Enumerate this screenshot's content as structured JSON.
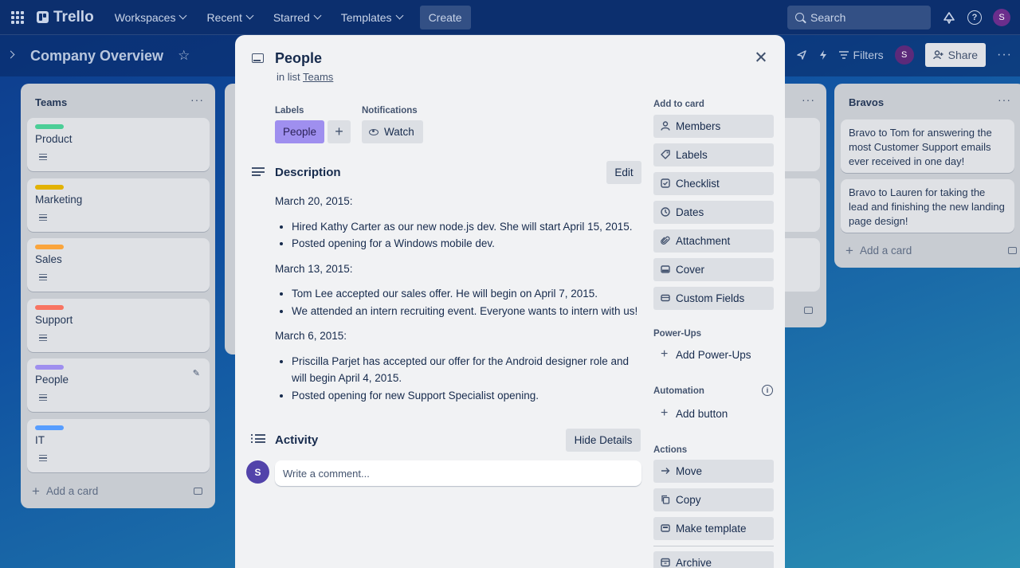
{
  "nav": {
    "logo": "Trello",
    "menus": [
      "Workspaces",
      "Recent",
      "Starred",
      "Templates"
    ],
    "create": "Create",
    "search_placeholder": "Search",
    "user_initial": "S"
  },
  "board": {
    "title": "Company Overview",
    "filters": "Filters",
    "share": "Share",
    "member_initial": "S"
  },
  "lists": {
    "teams": {
      "title": "Teams",
      "cards": [
        {
          "label": "Product",
          "color": "#4bce97"
        },
        {
          "label": "Marketing",
          "color": "#e2b203"
        },
        {
          "label": "Sales",
          "color": "#faa53d"
        },
        {
          "label": "Support",
          "color": "#f87462"
        },
        {
          "label": "People",
          "color": "#9f8fef"
        },
        {
          "label": "IT",
          "color": "#579dff"
        }
      ],
      "add_card": "Add a card"
    },
    "bravos": {
      "title": "Bravos",
      "cards": [
        "Bravo to Tom for answering the most Customer Support emails ever received in one day!",
        "Bravo to Lauren for taking the lead and finishing the new landing page design!"
      ],
      "add_card": "Add a card"
    }
  },
  "modal": {
    "title": "People",
    "in_list_prefix": "in list",
    "in_list_name": "Teams",
    "labels_heading": "Labels",
    "label_chip": "People",
    "notifications_heading": "Notifications",
    "watch": "Watch",
    "description_title": "Description",
    "edit": "Edit",
    "description": {
      "date1": "March 20, 2015:",
      "items1": [
        "Hired Kathy Carter as our new node.js dev. She will start April 15, 2015.",
        "Posted opening for a Windows mobile dev."
      ],
      "date2": "March 13, 2015:",
      "items2": [
        "Tom Lee accepted our sales offer. He will begin on April 7, 2015.",
        "We attended an intern recruiting event. Everyone wants to intern with us!"
      ],
      "date3": "March 6, 2015:",
      "items3": [
        "Priscilla Parjet has accepted our offer for the Android designer role and will begin April 4, 2015.",
        "Posted opening for new Support Specialist opening."
      ]
    },
    "activity_title": "Activity",
    "hide_details": "Hide Details",
    "avatar_initial": "S",
    "comment_placeholder": "Write a comment..."
  },
  "sidebar": {
    "add_to_card": "Add to card",
    "add_items": [
      "Members",
      "Labels",
      "Checklist",
      "Dates",
      "Attachment",
      "Cover",
      "Custom Fields"
    ],
    "power_ups": "Power-Ups",
    "add_power_ups": "Add Power-Ups",
    "automation": "Automation",
    "add_button": "Add button",
    "actions": "Actions",
    "action_items": [
      "Move",
      "Copy",
      "Make template",
      "Archive"
    ]
  }
}
